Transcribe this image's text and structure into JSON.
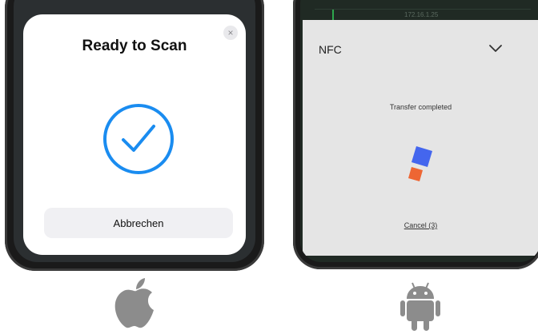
{
  "ios": {
    "title": "Ready to Scan",
    "cancel_label": "Abbrechen",
    "close_icon": "×",
    "icon": "checkmark-circle-icon",
    "accent_color": "#1a8cf0"
  },
  "android": {
    "header_title": "NFC",
    "status_text": "Transfer completed",
    "cancel_label": "Cancel (3)",
    "status_bar_text": "172.16.1.25",
    "icon": "app-logo-icon",
    "logo_colors": [
      "#4466ee",
      "#ee6633"
    ]
  },
  "platform_logos": {
    "left": "apple-logo-icon",
    "right": "android-logo-icon",
    "color": "#8c8c8c"
  }
}
